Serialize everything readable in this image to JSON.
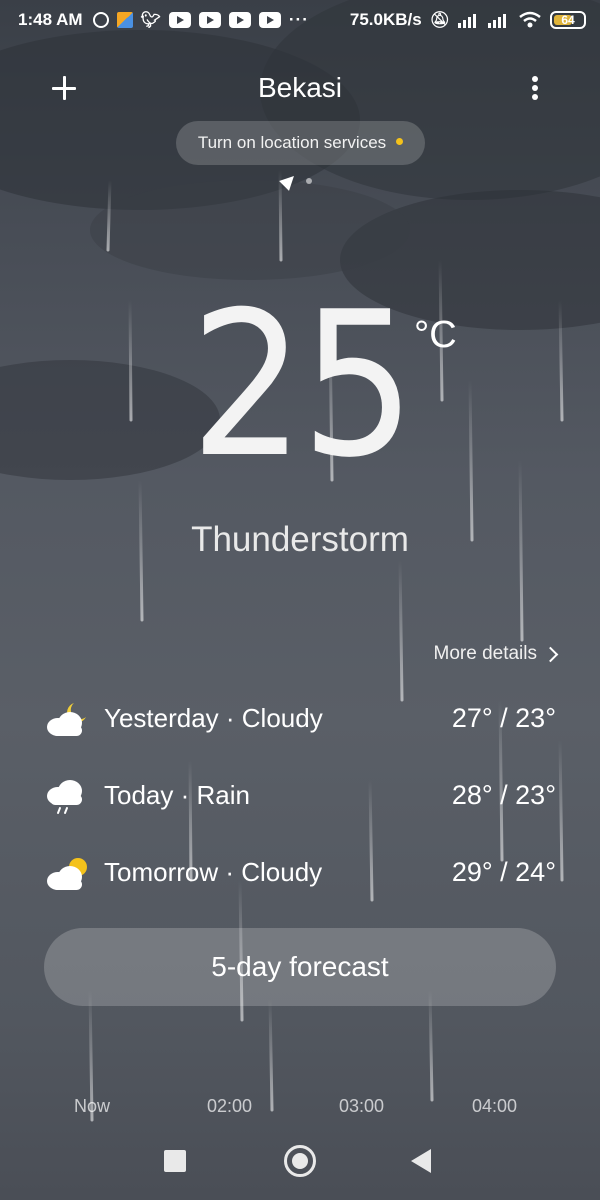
{
  "status_bar": {
    "time": "1:48 AM",
    "network_speed": "75.0KB/s",
    "battery": "64",
    "icons": [
      "chat-icon",
      "app-icon",
      "twitter-icon",
      "youtube-icon",
      "youtube-icon",
      "youtube-icon",
      "youtube-icon",
      "more-dots-icon",
      "mute-icon",
      "signal-icon",
      "signal-icon",
      "wifi-icon",
      "battery-icon"
    ]
  },
  "header": {
    "city": "Bekasi"
  },
  "location_banner": {
    "text": "Turn on location services"
  },
  "current": {
    "temperature": "25",
    "unit": "°C",
    "condition": "Thunderstorm"
  },
  "more_details_label": "More details",
  "daily": [
    {
      "label": "Yesterday · Cloudy",
      "range": "27° / 23°",
      "icon": "cloudy-night-icon"
    },
    {
      "label": "Today · Rain",
      "range": "28° / 23°",
      "icon": "rain-icon"
    },
    {
      "label": "Tomorrow · Cloudy",
      "range": "29° / 24°",
      "icon": "cloudy-day-icon"
    }
  ],
  "five_day_label": "5-day forecast",
  "hourly": [
    "Now",
    "02:00",
    "03:00",
    "04:00"
  ],
  "colors": {
    "accent_dot": "#f4c21b",
    "moon": "#f2cf3a",
    "sun": "#f4c21b"
  }
}
